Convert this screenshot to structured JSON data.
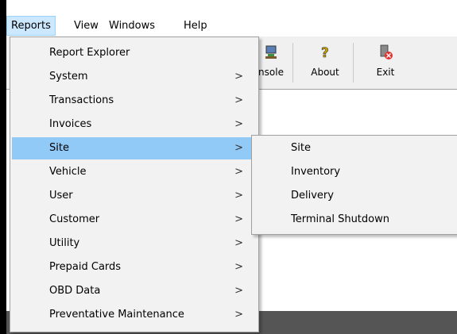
{
  "menubar": {
    "items": [
      "Reports",
      "View",
      "Windows",
      "Help"
    ]
  },
  "toolbar": {
    "buttons": [
      {
        "label": "nsole",
        "icon": "console-icon"
      },
      {
        "label": "About",
        "icon": "question-icon"
      },
      {
        "label": "Exit",
        "icon": "exit-icon"
      }
    ]
  },
  "reports_menu": {
    "items": [
      {
        "label": "Report Explorer",
        "has_submenu": false
      },
      {
        "label": "System",
        "has_submenu": true
      },
      {
        "label": "Transactions",
        "has_submenu": true
      },
      {
        "label": "Invoices",
        "has_submenu": true
      },
      {
        "label": "Site",
        "has_submenu": true,
        "highlighted": true
      },
      {
        "label": "Vehicle",
        "has_submenu": true
      },
      {
        "label": "User",
        "has_submenu": true
      },
      {
        "label": "Customer",
        "has_submenu": true
      },
      {
        "label": "Utility",
        "has_submenu": true
      },
      {
        "label": "Prepaid Cards",
        "has_submenu": true
      },
      {
        "label": "OBD Data",
        "has_submenu": true
      },
      {
        "label": "Preventative Maintenance",
        "has_submenu": true
      }
    ],
    "arrow": ">"
  },
  "site_submenu": {
    "items": [
      {
        "label": "Site"
      },
      {
        "label": "Inventory"
      },
      {
        "label": "Delivery"
      },
      {
        "label": "Terminal Shutdown"
      }
    ]
  },
  "colors": {
    "menu_bg": "#f2f2f2",
    "highlight": "#91c9f7",
    "menubar_active": "#cce8ff"
  }
}
